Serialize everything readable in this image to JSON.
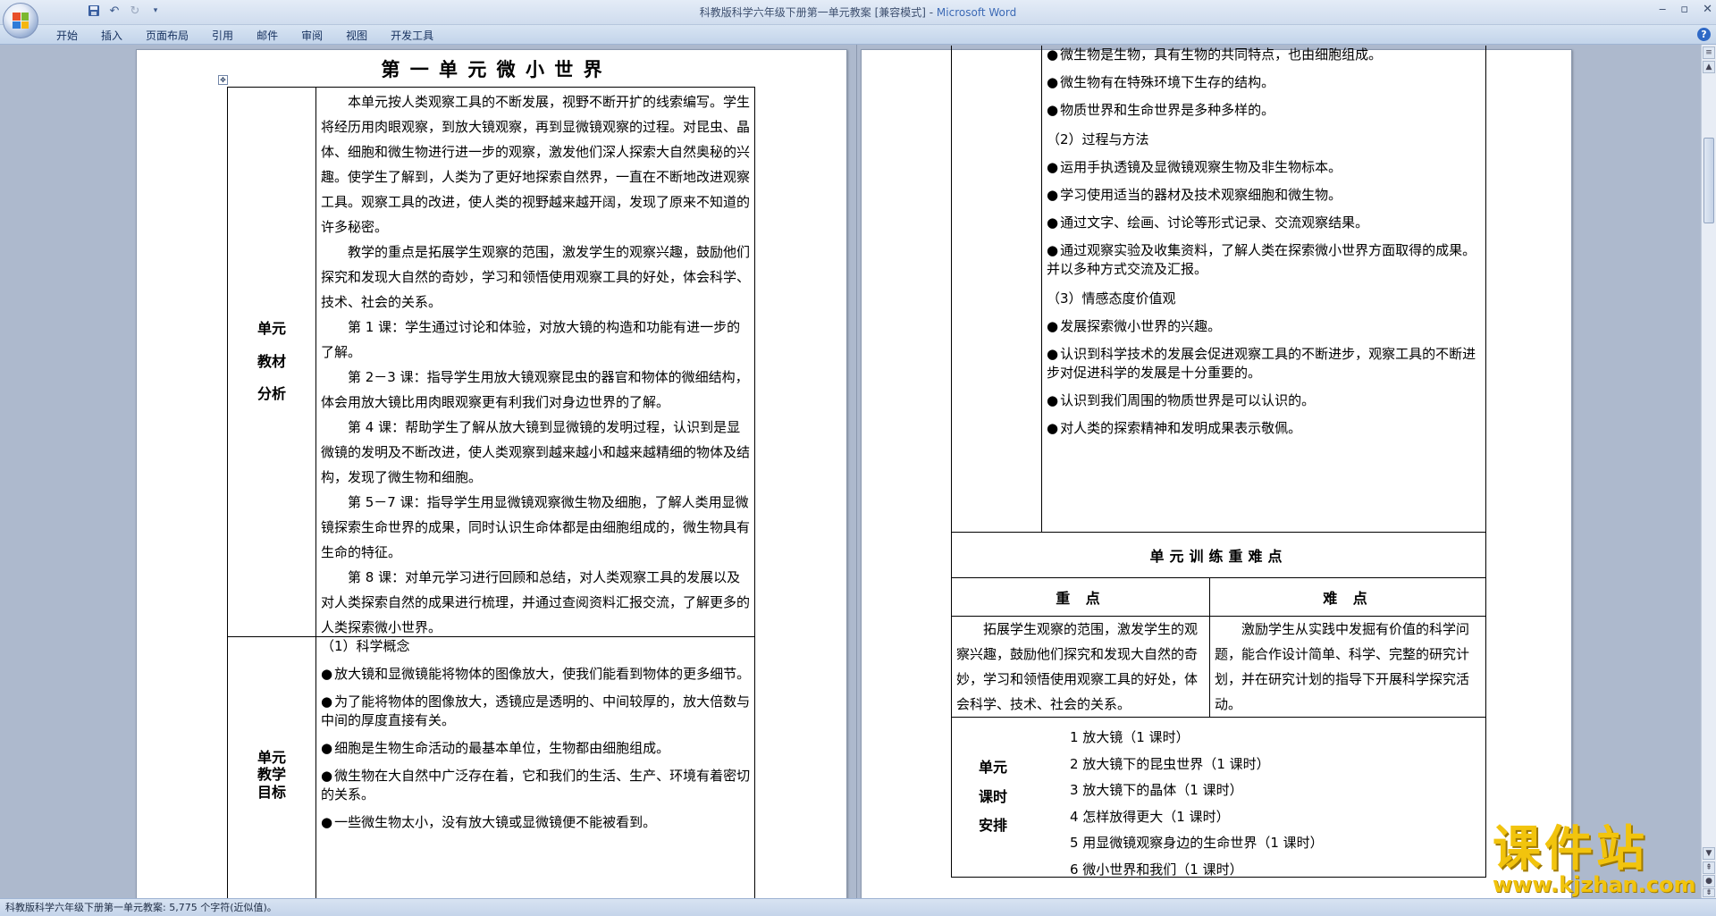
{
  "window": {
    "title": "科教版科学六年级下册第一单元教案 [兼容模式] - ",
    "app": "Microsoft Word",
    "controls": [
      "‒",
      "▫",
      "✕"
    ]
  },
  "ribbon": {
    "tabs": [
      "开始",
      "插入",
      "页面布局",
      "引用",
      "邮件",
      "审阅",
      "视图",
      "开发工具"
    ],
    "help": "?"
  },
  "status": {
    "text": "科教版科学六年级下册第一单元教案: 5,775 个字符(近似值)。"
  },
  "left_page": {
    "title": "第 一 单 元   微 小 世 界",
    "analysis_label": [
      "单元",
      "教材",
      "分析"
    ],
    "analysis_paragraphs": [
      "本单元按人类观察工具的不断发展，视野不断开扩的线索编写。学生将经历用肉眼观察，到放大镜观察，再到显微镜观察的过程。对昆虫、晶体、细胞和微生物进行进一步的观察，激发他们深人探索大自然奥秘的兴趣。使学生了解到，人类为了更好地探索自然界，一直在不断地改进观察工具。观察工具的改进，使人类的视野越来越开阔，发现了原来不知道的许多秘密。",
      "教学的重点是拓展学生观察的范围，激发学生的观察兴趣，鼓励他们探究和发现大自然的奇妙，学习和领悟使用观察工具的好处，体会科学、技术、社会的关系。",
      "第 1 课：学生通过讨论和体验，对放大镜的构造和功能有进一步的了解。",
      "第 2－3 课：指导学生用放大镜观察昆虫的器官和物体的微细结构，体会用放大镜比用肉眼观察更有利我们对身边世界的了解。",
      "第 4 课：帮助学生了解从放大镜到显微镜的发明过程，认识到是显微镜的发明及不断改进，使人类观察到越来越小和越来越精细的物体及结构，发现了微生物和细胞。",
      "第 5－7 课：指导学生用显微镜观察微生物及细胞，了解人类用显微镜探索生命世界的成果，同时认识生命体都是由细胞组成的，微生物具有生命的特征。",
      "第 8 课：对单元学习进行回顾和总结，对人类观察工具的发展以及对人类探索自然的成果进行梳理，并通过查阅资料汇报交流，了解更多的人类探索微小世界。"
    ],
    "goals_label": [
      "单元",
      "教学",
      "目标"
    ],
    "goals_section": "（1）科学概念",
    "goals_bullets": [
      "放大镜和显微镜能将物体的图像放大，使我们能看到物体的更多细节。",
      "为了能将物体的图像放大，透镜应是透明的、中间较厚的，放大倍数与中间的厚度直接有关。",
      "细胞是生物生命活动的最基本单位，生物都由细胞组成。",
      "微生物在大自然中广泛存在着，它和我们的生活、生产、环境有着密切的关系。",
      "一些微生物太小，没有放大镜或显微镜便不能被看到。"
    ]
  },
  "right_page": {
    "bullets_1": [
      "微生物是生物，具有生物的共同特点，也由细胞组成。",
      "微生物有在特殊环境下生存的结构。",
      "物质世界和生命世界是多种多样的。"
    ],
    "section_2": "（2）过程与方法",
    "bullets_2": [
      "运用手执透镜及显微镜观察生物及非生物标本。",
      "学习使用适当的器材及技术观察细胞和微生物。",
      "通过文字、绘画、讨论等形式记录、交流观察结果。",
      "通过观察实验及收集资料，了解人类在探索微小世界方面取得的成果。并以多种方式交流及汇报。"
    ],
    "section_3": "（3）情感态度价值观",
    "bullets_3": [
      "发展探索微小世界的兴趣。",
      "认识到科学技术的发展会促进观察工具的不断进步，观察工具的不断进步对促进科学的发展是十分重要的。",
      "认识到我们周围的物质世界是可以认识的。",
      "对人类的探索精神和发明成果表示敬佩。"
    ],
    "difficulty_title": "单元训练重难点",
    "key_header": "重 点",
    "hard_header": "难 点",
    "key_text": "拓展学生观察的范围，激发学生的观察兴趣，鼓励他们探究和发现大自然的奇妙，学习和领悟使用观察工具的好处，体会科学、技术、社会的关系。",
    "hard_text": "激励学生从实践中发掘有价值的科学问题，能合作设计简单、科学、完整的研究计划，并在研究计划的指导下开展科学探究活动。",
    "schedule_label": [
      "单元",
      "课时",
      "安排"
    ],
    "schedule": [
      "1 放大镜（1 课时）",
      "2 放大镜下的昆虫世界（1 课时）",
      "3 放大镜下的晶体（1 课时）",
      "4 怎样放得更大（1 课时）",
      "5 用显微镜观察身边的生命世界（1 课时）",
      "6 微小世界和我们（1 课时）"
    ]
  },
  "watermark": {
    "text": "课件站",
    "url": "www.kjzhan.com"
  }
}
